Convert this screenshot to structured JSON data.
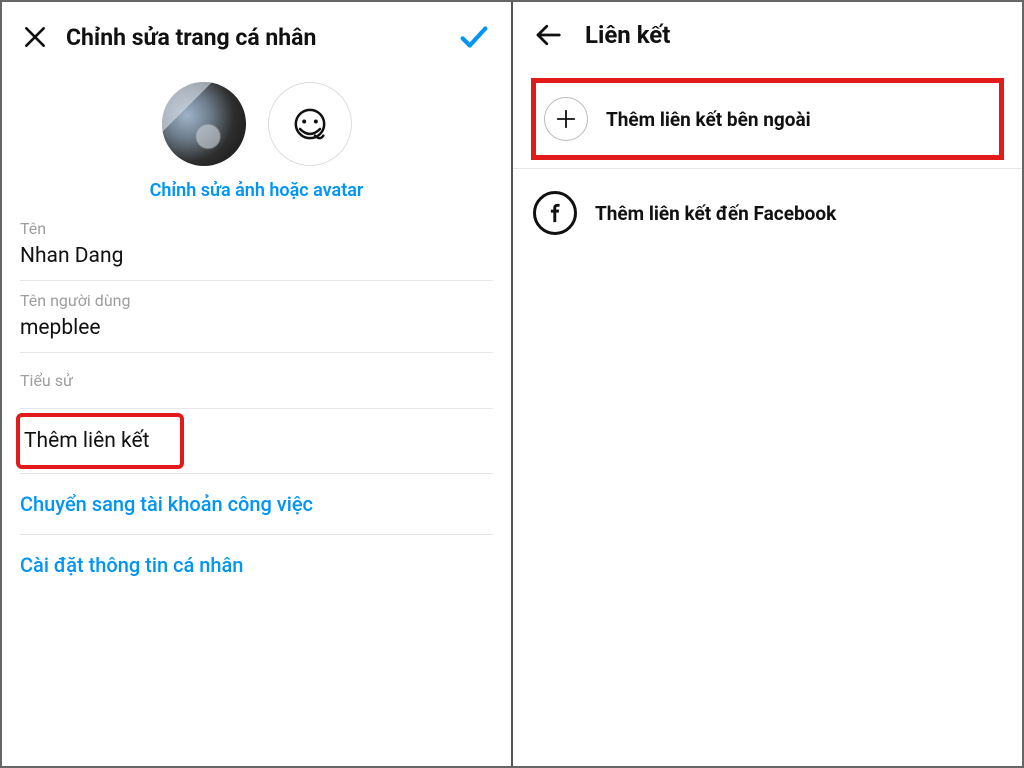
{
  "left": {
    "title": "Chỉnh sửa trang cá nhân",
    "editPhoto": "Chỉnh sửa ảnh hoặc avatar",
    "fields": {
      "nameLabel": "Tên",
      "nameValue": "Nhan Dang",
      "usernameLabel": "Tên người dùng",
      "usernameValue": "mepblee",
      "bioLabel": "Tiểu sử"
    },
    "addLink": "Thêm liên kết",
    "switchAccount": "Chuyển sang tài khoản công việc",
    "personalInfo": "Cài đặt thông tin cá nhân"
  },
  "right": {
    "title": "Liên kết",
    "addExternal": "Thêm liên kết bên ngoài",
    "addFacebook": "Thêm liên kết đến Facebook"
  },
  "colors": {
    "accent": "#0095f6",
    "highlight": "#e21a1a"
  }
}
